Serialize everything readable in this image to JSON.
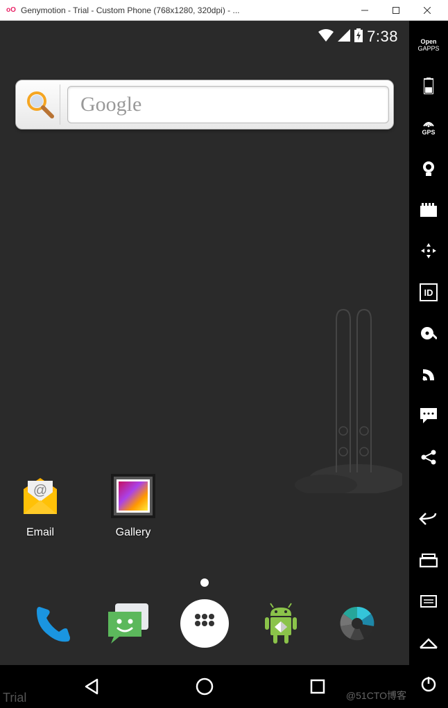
{
  "window": {
    "icon": "oO",
    "title": "Genymotion - Trial - Custom Phone (768x1280, 320dpi) - ..."
  },
  "status_bar": {
    "time": "7:38"
  },
  "search_widget": {
    "placeholder": "Google"
  },
  "home_apps": [
    {
      "name": "email-app",
      "label": "Email"
    },
    {
      "name": "gallery-app",
      "label": "Gallery"
    }
  ],
  "dock_apps": [
    {
      "name": "phone-app"
    },
    {
      "name": "messages-app"
    },
    {
      "name": "all-apps-button"
    },
    {
      "name": "android-app"
    },
    {
      "name": "camera-app"
    }
  ],
  "side_tools": [
    {
      "name": "open-gapps",
      "label1": "Open",
      "label2": "GAPPS"
    },
    {
      "name": "battery-tool"
    },
    {
      "name": "gps-tool",
      "label": "GPS"
    },
    {
      "name": "camera-tool"
    },
    {
      "name": "screen-recorder-tool"
    },
    {
      "name": "move-tool"
    },
    {
      "name": "identifiers-tool",
      "label": "ID"
    },
    {
      "name": "disk-io-tool"
    },
    {
      "name": "network-tool"
    },
    {
      "name": "sms-tool"
    },
    {
      "name": "share-tool"
    },
    {
      "name": "android-back-button"
    },
    {
      "name": "android-recent-button"
    },
    {
      "name": "android-menu-button"
    },
    {
      "name": "android-home-button"
    },
    {
      "name": "power-button"
    }
  ],
  "watermark": {
    "trial": "Trial",
    "cto": "@51CTO博客"
  }
}
